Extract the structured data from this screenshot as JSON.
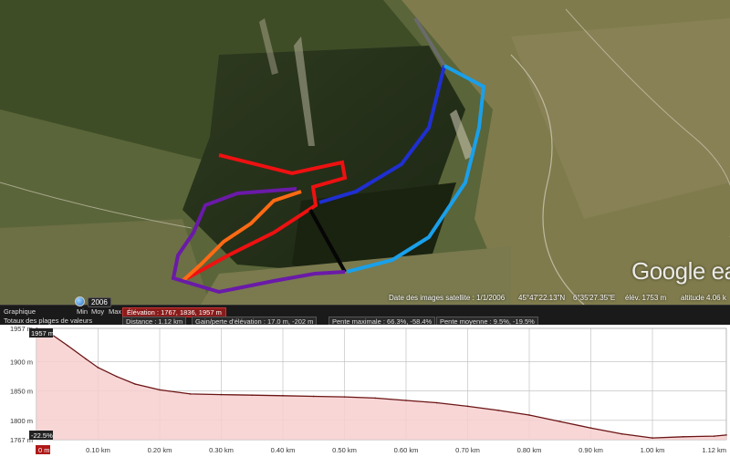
{
  "map": {
    "watermark": "Google ea",
    "imagery_date": "Date des images satellite : 1/1/2006",
    "latitude": "45°47'22.13\"N",
    "longitude": "6°35'27.35\"E",
    "elevation": "élév. 1753 m",
    "altitude": "altitude  4.06 k"
  },
  "toolbar": {
    "year": "2006",
    "graph_label": "Graphique",
    "min_label": "Min",
    "avg_label": "Moy",
    "max_label": "Max",
    "elevation_summary": "Élévation : 1767, 1836, 1957 m",
    "totals_label": "Totaux des plages de valeurs",
    "distance": "Distance : 1.12 km",
    "gain_loss": "Gain/perte d'élévation : 17.0 m, -202 m",
    "max_slope": "Pente maximale : 66.3%, -58.4%",
    "avg_slope": "Pente moyenne : 9.5%, -19.5%"
  },
  "chart_data": {
    "type": "area",
    "ylabel": "",
    "xlabel": "",
    "ylim": [
      1767,
      1957
    ],
    "xlim": [
      0,
      1.12
    ],
    "y_ticks": [
      "1957 m",
      "1900 m",
      "1850 m",
      "1800 m",
      "1767 m"
    ],
    "y_tick_values": [
      1957,
      1900,
      1850,
      1800,
      1767
    ],
    "x_ticks": [
      "0 m",
      "0.10 km",
      "0.20 km",
      "0.30 km",
      "0.40 km",
      "0.50 km",
      "0.60 km",
      "0.70 km",
      "0.80 km",
      "0.90 km",
      "1.00 km",
      "1.12 km"
    ],
    "x_tick_values": [
      0,
      0.1,
      0.2,
      0.3,
      0.4,
      0.5,
      0.6,
      0.7,
      0.8,
      0.9,
      1.0,
      1.12
    ],
    "max_badge": "1957 m",
    "min_badge": "-22.5%",
    "x": [
      0,
      0.02,
      0.05,
      0.08,
      0.1,
      0.13,
      0.16,
      0.2,
      0.25,
      0.3,
      0.35,
      0.4,
      0.45,
      0.5,
      0.55,
      0.6,
      0.65,
      0.7,
      0.75,
      0.8,
      0.85,
      0.9,
      0.95,
      1.0,
      1.05,
      1.1,
      1.12
    ],
    "values": [
      1957,
      1950,
      1928,
      1905,
      1890,
      1875,
      1862,
      1852,
      1845,
      1844,
      1843,
      1842,
      1841,
      1840,
      1838,
      1834,
      1830,
      1824,
      1817,
      1809,
      1798,
      1787,
      1777,
      1770,
      1772,
      1773,
      1775
    ],
    "colors": {
      "line": "#6b1414",
      "fill": "#f7cfcf",
      "grid": "#bbbbbb"
    }
  }
}
